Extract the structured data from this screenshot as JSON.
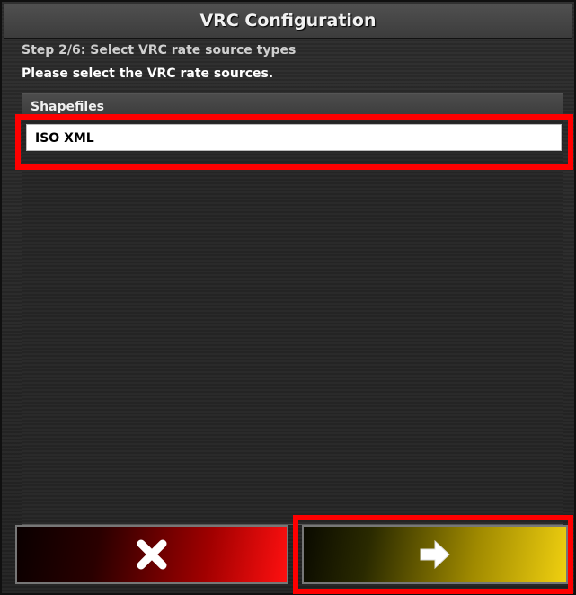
{
  "dialog": {
    "title": "VRC Configuration",
    "step_text": "Step 2/6: Select VRC rate source types",
    "instruction": "Please select the VRC rate sources."
  },
  "list": {
    "items": [
      {
        "label": "Shapefiles",
        "selected": false
      },
      {
        "label": "ISO XML",
        "selected": true
      }
    ]
  },
  "buttons": {
    "cancel": {
      "icon": "close-icon",
      "color": "#ff1010"
    },
    "next": {
      "icon": "arrow-right-icon",
      "color": "#f0d010"
    }
  },
  "colors": {
    "highlight": "#ff0000",
    "selected_bg": "#ffffff"
  }
}
